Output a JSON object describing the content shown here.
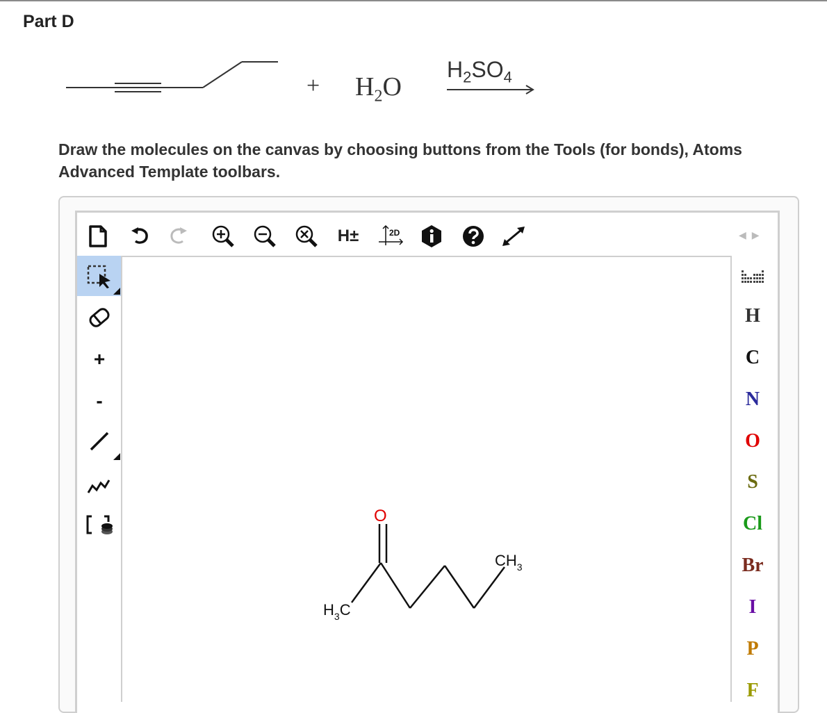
{
  "part": {
    "title": "Part D"
  },
  "reaction": {
    "plus": "+",
    "water": {
      "main": "H",
      "sub": "2",
      "tail": "O"
    },
    "reagent": {
      "main": "H",
      "sub1": "2",
      "mid": "SO",
      "sub2": "4"
    }
  },
  "instructions": {
    "line1": "Draw the molecules on the canvas by choosing buttons from the Tools (for bonds), Atoms",
    "line2": "Advanced Template toolbars."
  },
  "top_toolbar": {
    "h_toggle": "H±",
    "clean_label": "2D",
    "icons": [
      "new-document-icon",
      "undo-icon",
      "redo-icon",
      "zoom-in-icon",
      "zoom-out-icon",
      "zoom-reset-icon",
      "hydrogen-toggle",
      "clean-2d-icon",
      "info-icon",
      "help-icon",
      "fullscreen-icon"
    ]
  },
  "left_toolbar": {
    "plus_charge": "+",
    "minus_charge": "-",
    "icons": [
      "select-icon",
      "eraser-icon",
      "charge-plus",
      "charge-minus",
      "single-bond-icon",
      "chain-icon",
      "template-icon"
    ]
  },
  "right_toolbar": {
    "atoms": [
      {
        "symbol": "H",
        "color": "#333333"
      },
      {
        "symbol": "C",
        "color": "#111111"
      },
      {
        "symbol": "N",
        "color": "#2b2b9c"
      },
      {
        "symbol": "O",
        "color": "#e00000"
      },
      {
        "symbol": "S",
        "color": "#6b6b10"
      },
      {
        "symbol": "Cl",
        "color": "#1a9a1a"
      },
      {
        "symbol": "Br",
        "color": "#7a2b1e"
      },
      {
        "symbol": "I",
        "color": "#6a0fa5"
      },
      {
        "symbol": "P",
        "color": "#c07a00"
      },
      {
        "symbol": "F",
        "color": "#9a9a00"
      }
    ]
  },
  "canvas_molecule": {
    "oxygen": "O",
    "ch3_main": "CH",
    "ch3_sub": "3",
    "h3c_main": "H",
    "h3c_sub": "3",
    "h3c_tail": "C"
  }
}
